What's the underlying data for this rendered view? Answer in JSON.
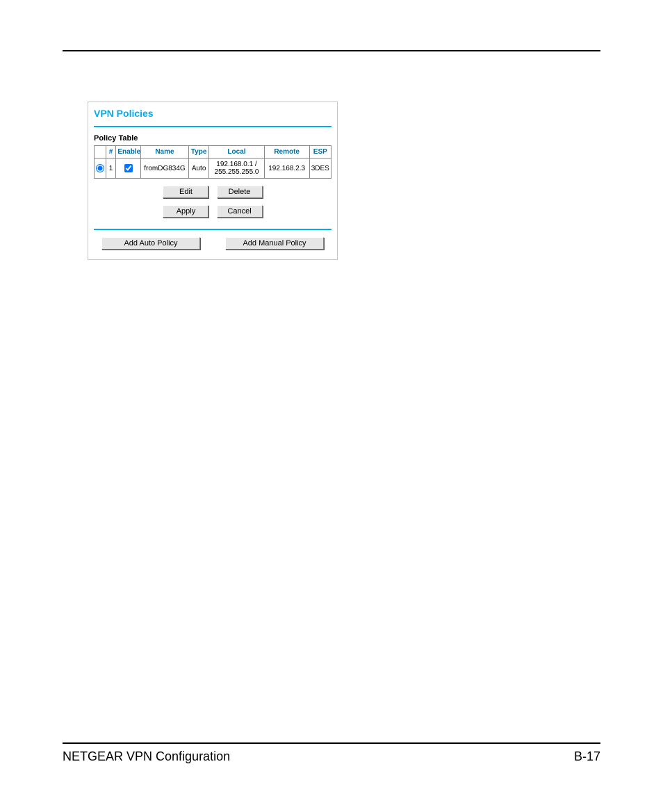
{
  "footer": {
    "title": "NETGEAR VPN Configuration",
    "page": "B-17"
  },
  "panel": {
    "title": "VPN Policies",
    "section_label": "Policy Table",
    "headers": {
      "radio": "",
      "num": "#",
      "enable": "Enable",
      "name": "Name",
      "type": "Type",
      "local": "Local",
      "remote": "Remote",
      "esp": "ESP"
    },
    "row": {
      "selected": true,
      "num": "1",
      "enabled": true,
      "name": "fromDG834G",
      "type": "Auto",
      "local": "192.168.0.1 / 255.255.255.0",
      "remote": "192.168.2.3",
      "esp": "3DES"
    },
    "buttons": {
      "edit": "Edit",
      "delete": "Delete",
      "apply": "Apply",
      "cancel": "Cancel",
      "add_auto": "Add Auto Policy",
      "add_manual": "Add Manual Policy"
    }
  }
}
